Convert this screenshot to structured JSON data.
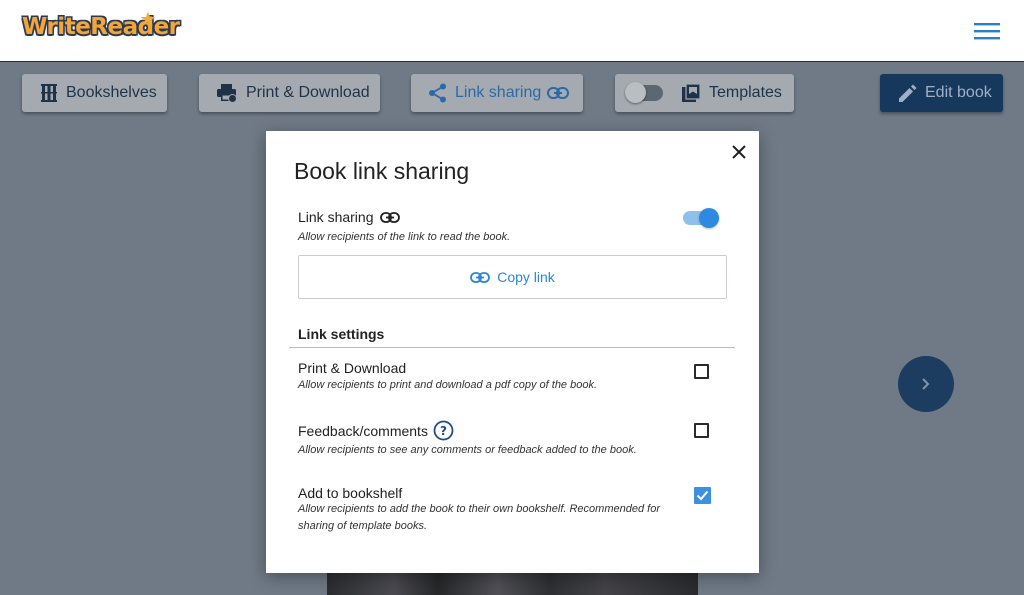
{
  "header": {
    "logo_text": "WriteReader",
    "logo_star_color": "#f4a93c",
    "menu_icon": "hamburger-icon"
  },
  "toolbar": {
    "bookshelves_label": "Bookshelves",
    "print_download_label": "Print & Download",
    "link_sharing_label": "Link sharing",
    "templates_label": "Templates",
    "templates_toggle_on": false,
    "edit_book_label": "Edit book",
    "accent_color": "#17385d"
  },
  "modal": {
    "title": "Book link sharing",
    "link_sharing": {
      "label": "Link sharing",
      "description": "Allow recipients of the link to read the book.",
      "enabled": true
    },
    "copy_link_label": "Copy link",
    "link_settings_title": "Link settings",
    "settings": [
      {
        "label": "Print & Download",
        "description": "Allow recipients to print and download a pdf copy of the book.",
        "checked": false
      },
      {
        "label": "Feedback/comments",
        "description": "Allow recipients to see any comments or feedback added to the book.",
        "checked": false
      },
      {
        "label": "Add to bookshelf",
        "description_line1": "Allow recipients to add the book to their own bookshelf. Recommended for",
        "description_line2": "sharing of template books.",
        "checked": true
      }
    ],
    "checkbox_color": "#3d8fe0",
    "toggle_color": "#2d8ae0"
  }
}
